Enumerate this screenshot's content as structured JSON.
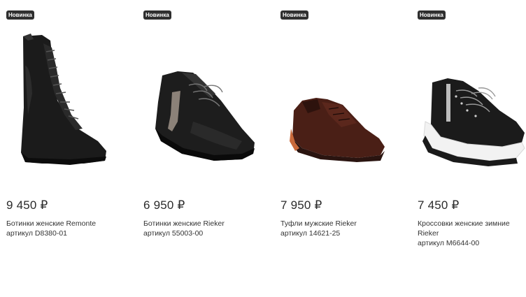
{
  "products": [
    {
      "badge": "Новинка",
      "price": "9 450 ₽",
      "title": "Ботинки женские Remonte",
      "sku": "артикул D8380-01",
      "image_icon": "black-lace-up-boot"
    },
    {
      "badge": "Новинка",
      "price": "6 950 ₽",
      "title": "Ботинки женские Rieker",
      "sku": "артикул 55003-00",
      "image_icon": "black-suede-high-sneaker"
    },
    {
      "badge": "Новинка",
      "price": "7 950 ₽",
      "title": "Туфли мужские Rieker",
      "sku": "артикул 14621-25",
      "image_icon": "brown-leather-derby-shoe"
    },
    {
      "badge": "Новинка",
      "price": "7 450 ₽",
      "title": "Кроссовки женские зимние Rieker",
      "sku": "артикул M6644-00",
      "image_icon": "black-high-top-sneaker"
    }
  ],
  "colors": {
    "badge_bg": "#2f2f2f",
    "badge_text": "#ffffff",
    "text": "#333333"
  }
}
